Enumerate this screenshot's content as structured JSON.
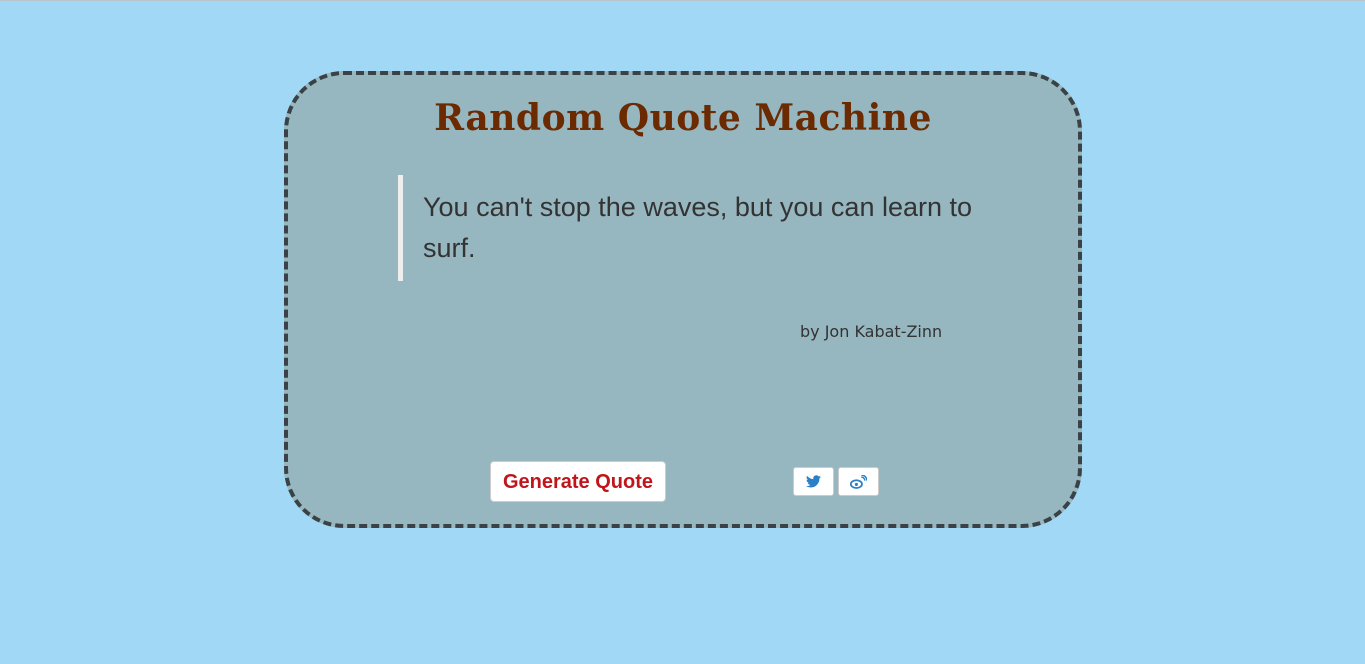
{
  "title": "Random Quote Machine",
  "quote": {
    "text": "You can't stop the waves, but you can learn to surf.",
    "author": "by Jon Kabat-Zinn"
  },
  "buttons": {
    "generate": "Generate Quote",
    "twitter_icon": "twitter-icon",
    "weibo_icon": "weibo-icon"
  },
  "colors": {
    "background": "#a0d8f6",
    "card": "#96b6c0",
    "title": "#6b2a00",
    "button_text": "#c0161b",
    "icon": "#2a7fc9"
  }
}
